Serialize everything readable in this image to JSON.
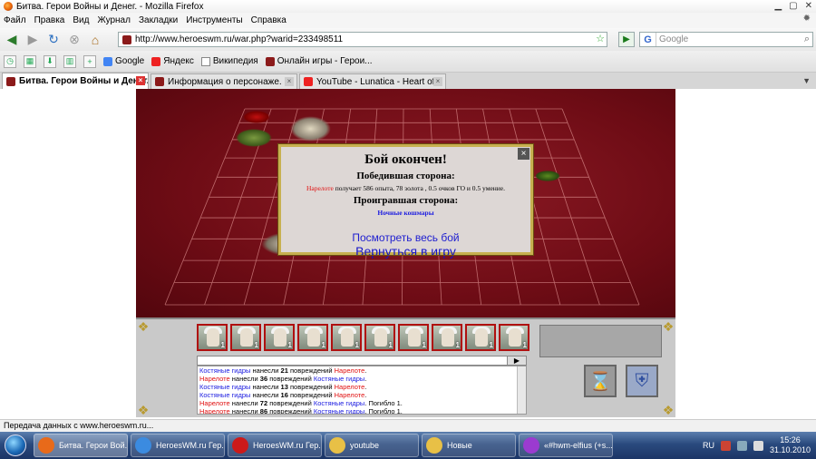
{
  "window": {
    "title": "Битва. Герои Войны и Денег. - Mozilla Firefox"
  },
  "menu": [
    "Файл",
    "Правка",
    "Вид",
    "Журнал",
    "Закладки",
    "Инструменты",
    "Справка"
  ],
  "navigation": {
    "url": "http://www.heroeswm.ru/war.php?warid=233498511",
    "search_placeholder": "Google",
    "search_engine": "G"
  },
  "bookmarks": [
    {
      "label": "Google"
    },
    {
      "label": "Яндекс"
    },
    {
      "label": "Википедия"
    },
    {
      "label": "Онлайн игры - Герои..."
    }
  ],
  "tabs": [
    {
      "label": "Битва. Герои Войны и Денег.",
      "active": true
    },
    {
      "label": "Информация о персонаже.",
      "active": false
    },
    {
      "label": "YouTube - Lunatica - Heart of a Lion",
      "active": false
    }
  ],
  "battle_result": {
    "title": "Бой окончен!",
    "winners_heading": "Победившая сторона:",
    "winner_name": "Нарелоте",
    "winner_reward": " получает 586 опыта, 78 золота ,  0.5 очков ГО и 0.5 умение.",
    "losers_heading": "Проигравшая сторона:",
    "loser_name": "Ночные кошмары",
    "view_battle_link": "Посмотреть весь бой",
    "return_link": "Вернуться в игру",
    "close_label": "×"
  },
  "army": {
    "count_label": "1",
    "slots": 10
  },
  "combat_log": [
    {
      "actor": "Костяные гидры",
      "actor_side": "blue",
      "verb": " нанесли ",
      "amount": "21",
      "rest": " повреждений ",
      "target": "Нарелоте",
      "target_side": "red",
      "suffix": "."
    },
    {
      "actor": "Нарелоте",
      "actor_side": "red",
      "verb": " нанесли ",
      "amount": "36",
      "rest": " повреждений ",
      "target": "Костяные гидры",
      "target_side": "blue",
      "suffix": "."
    },
    {
      "actor": "Костяные гидры",
      "actor_side": "blue",
      "verb": " нанесли ",
      "amount": "13",
      "rest": " повреждений ",
      "target": "Нарелоте",
      "target_side": "red",
      "suffix": "."
    },
    {
      "actor": "Костяные гидры",
      "actor_side": "blue",
      "verb": " нанесли ",
      "amount": "16",
      "rest": " повреждений ",
      "target": "Нарелоте",
      "target_side": "red",
      "suffix": "."
    },
    {
      "actor": "Нарелоте",
      "actor_side": "red",
      "verb": " нанесли ",
      "amount": "72",
      "rest": " повреждений ",
      "target": "Костяные гидры",
      "target_side": "blue",
      "suffix": ". Погибло 1."
    },
    {
      "actor": "Нарелоте",
      "actor_side": "red",
      "verb": " нанесли ",
      "amount": "86",
      "rest": " повреждений ",
      "target": "Костяные гидры",
      "target_side": "blue",
      "suffix": ". Погибло 1."
    }
  ],
  "status_bar": {
    "text": "Передача данных с www.heroeswm.ru..."
  },
  "taskbar": {
    "items": [
      {
        "label": "Битва. Герои Вой...",
        "icon": "firefox-icon",
        "color": "#e86a1a",
        "active": true
      },
      {
        "label": "HeroesWM.ru Гер...",
        "icon": "ie-icon",
        "color": "#3b8be0",
        "active": false
      },
      {
        "label": "HeroesWM.ru Гер...",
        "icon": "opera-icon",
        "color": "#cc1a1a",
        "active": false
      },
      {
        "label": "youtube",
        "icon": "folder-icon",
        "color": "#e8c046",
        "active": false
      },
      {
        "label": "Новые",
        "icon": "folder-icon",
        "color": "#e8c046",
        "active": false
      },
      {
        "label": "«#hwm-elfius (+s...",
        "icon": "irc-icon",
        "color": "#9b3bd0",
        "active": false
      }
    ],
    "language": "RU",
    "time": "15:26",
    "date": "31.10.2010"
  },
  "colors": {
    "player": "#e01010",
    "enemy": "#1a1ae0",
    "battlefield": "#7a101a"
  }
}
